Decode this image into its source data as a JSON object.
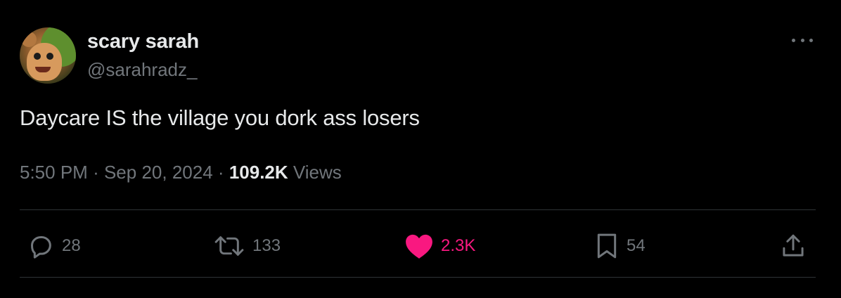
{
  "author": {
    "display_name": "scary sarah",
    "handle": "@sarahradz_"
  },
  "tweet": {
    "text": "Daycare IS the village you dork ass losers",
    "time": "5:50 PM",
    "separator": "·",
    "date": "Sep 20, 2024",
    "views_count": "109.2K",
    "views_label": "Views"
  },
  "actions": {
    "replies": "28",
    "reposts": "133",
    "likes": "2.3K",
    "bookmarks": "54"
  },
  "colors": {
    "background": "#000000",
    "primary_text": "#e7e9ea",
    "secondary_text": "#71767b",
    "like_active": "#f91880",
    "divider": "#2f3336"
  },
  "icons": {
    "reply": "reply-icon",
    "repost": "repost-icon",
    "like": "heart-icon",
    "bookmark": "bookmark-icon",
    "share": "share-icon",
    "more": "more-icon"
  }
}
